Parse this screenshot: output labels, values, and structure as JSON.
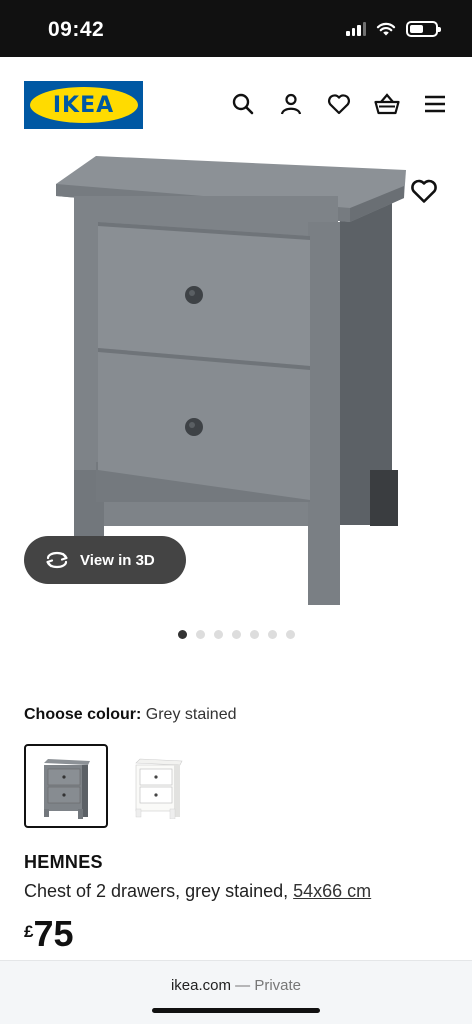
{
  "status": {
    "time": "09:42"
  },
  "header": {
    "logo_text": "IKEA",
    "icons": [
      "search-icon",
      "user-icon",
      "heart-icon",
      "basket-icon",
      "menu-icon"
    ]
  },
  "gallery": {
    "view3d_label": "View in 3D",
    "dot_count": 7,
    "active_dot": 1
  },
  "colour": {
    "label": "Choose colour:",
    "value": "Grey stained",
    "options": [
      "Grey stained",
      "White stained"
    ]
  },
  "product": {
    "name": "HEMNES",
    "description": "Chest of 2 drawers, grey stained,",
    "size_link": "54x66 cm",
    "currency": "£",
    "price": "75"
  },
  "browser": {
    "domain": "ikea.com",
    "separator": " — ",
    "mode": "Private"
  },
  "colors": {
    "ikea_blue": "#0058a3",
    "ikea_yellow": "#ffdb00",
    "furniture_grey": "#7a7f84"
  }
}
